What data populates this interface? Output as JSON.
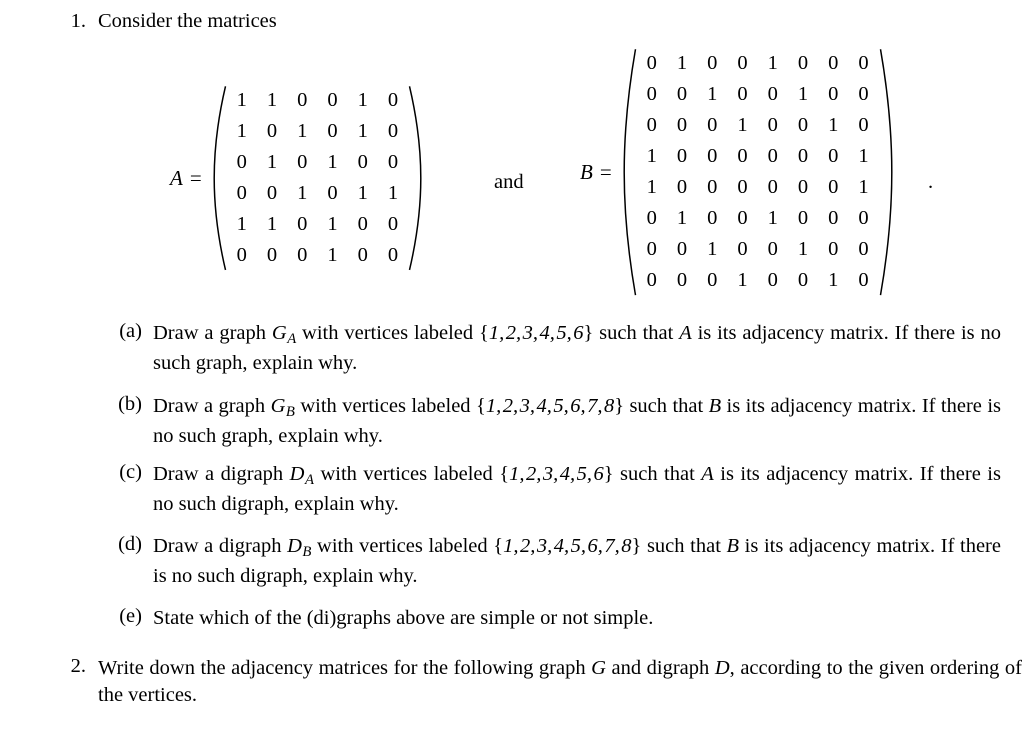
{
  "document": {
    "background_color": "#ffffff",
    "text_color": "#000000"
  },
  "problem1": {
    "number": "1.",
    "stem": "Consider the matrices",
    "connector": "and",
    "trailing_punctuation": ".",
    "matrix_A": {
      "name": "A",
      "equals": "=",
      "rows": 6,
      "cols": 6,
      "values": [
        [
          1,
          1,
          0,
          0,
          1,
          0
        ],
        [
          1,
          0,
          1,
          0,
          1,
          0
        ],
        [
          0,
          1,
          0,
          1,
          0,
          0
        ],
        [
          0,
          0,
          1,
          0,
          1,
          1
        ],
        [
          1,
          1,
          0,
          1,
          0,
          0
        ],
        [
          0,
          0,
          0,
          1,
          0,
          0
        ]
      ]
    },
    "matrix_B": {
      "name": "B",
      "equals": "=",
      "rows": 8,
      "cols": 8,
      "values": [
        [
          0,
          1,
          0,
          0,
          1,
          0,
          0,
          0
        ],
        [
          0,
          0,
          1,
          0,
          0,
          1,
          0,
          0
        ],
        [
          0,
          0,
          0,
          1,
          0,
          0,
          1,
          0
        ],
        [
          1,
          0,
          0,
          0,
          0,
          0,
          0,
          1
        ],
        [
          1,
          0,
          0,
          0,
          0,
          0,
          0,
          1
        ],
        [
          0,
          1,
          0,
          0,
          1,
          0,
          0,
          0
        ],
        [
          0,
          0,
          1,
          0,
          0,
          1,
          0,
          0
        ],
        [
          0,
          0,
          0,
          1,
          0,
          0,
          1,
          0
        ]
      ]
    },
    "parts": [
      {
        "label": "(a)",
        "segments": [
          {
            "t": "text",
            "v": "Draw a graph "
          },
          {
            "t": "var",
            "v": "G",
            "sub": "A"
          },
          {
            "t": "text",
            "v": " with vertices labeled "
          },
          {
            "t": "set",
            "v": [
              1,
              2,
              3,
              4,
              5,
              6
            ]
          },
          {
            "t": "text",
            "v": " such that "
          },
          {
            "t": "var",
            "v": "A"
          },
          {
            "t": "text",
            "v": " is its adjacency matrix. If there is no such graph, explain why."
          }
        ]
      },
      {
        "label": "(b)",
        "segments": [
          {
            "t": "text",
            "v": "Draw a graph "
          },
          {
            "t": "var",
            "v": "G",
            "sub": "B"
          },
          {
            "t": "text",
            "v": " with vertices labeled "
          },
          {
            "t": "set",
            "v": [
              1,
              2,
              3,
              4,
              5,
              6,
              7,
              8
            ]
          },
          {
            "t": "text",
            "v": " such that "
          },
          {
            "t": "var",
            "v": "B"
          },
          {
            "t": "text",
            "v": " is its adjacency matrix. If there is no such graph, explain why."
          }
        ]
      },
      {
        "label": "(c)",
        "segments": [
          {
            "t": "text",
            "v": "Draw a digraph "
          },
          {
            "t": "var",
            "v": "D",
            "sub": "A"
          },
          {
            "t": "text",
            "v": " with vertices labeled "
          },
          {
            "t": "set",
            "v": [
              1,
              2,
              3,
              4,
              5,
              6
            ]
          },
          {
            "t": "text",
            "v": " such that "
          },
          {
            "t": "var",
            "v": "A"
          },
          {
            "t": "text",
            "v": " is its adjacency matrix. If there is no such digraph, explain why."
          }
        ]
      },
      {
        "label": "(d)",
        "segments": [
          {
            "t": "text",
            "v": "Draw a digraph "
          },
          {
            "t": "var",
            "v": "D",
            "sub": "B"
          },
          {
            "t": "text",
            "v": " with vertices labeled "
          },
          {
            "t": "set",
            "v": [
              1,
              2,
              3,
              4,
              5,
              6,
              7,
              8
            ]
          },
          {
            "t": "text",
            "v": " such that "
          },
          {
            "t": "var",
            "v": "B"
          },
          {
            "t": "text",
            "v": " is its adjacency matrix. If there is no such digraph, explain why."
          }
        ]
      },
      {
        "label": "(e)",
        "segments": [
          {
            "t": "text",
            "v": "State which of the (di)graphs above are simple or not simple."
          }
        ]
      }
    ]
  },
  "problem2": {
    "number": "2.",
    "segments": [
      {
        "t": "text",
        "v": "Write down the adjacency matrices for the following graph "
      },
      {
        "t": "var",
        "v": "G"
      },
      {
        "t": "text",
        "v": " and digraph "
      },
      {
        "t": "var",
        "v": "D"
      },
      {
        "t": "text",
        "v": ", according to the given ordering of the vertices."
      }
    ]
  }
}
